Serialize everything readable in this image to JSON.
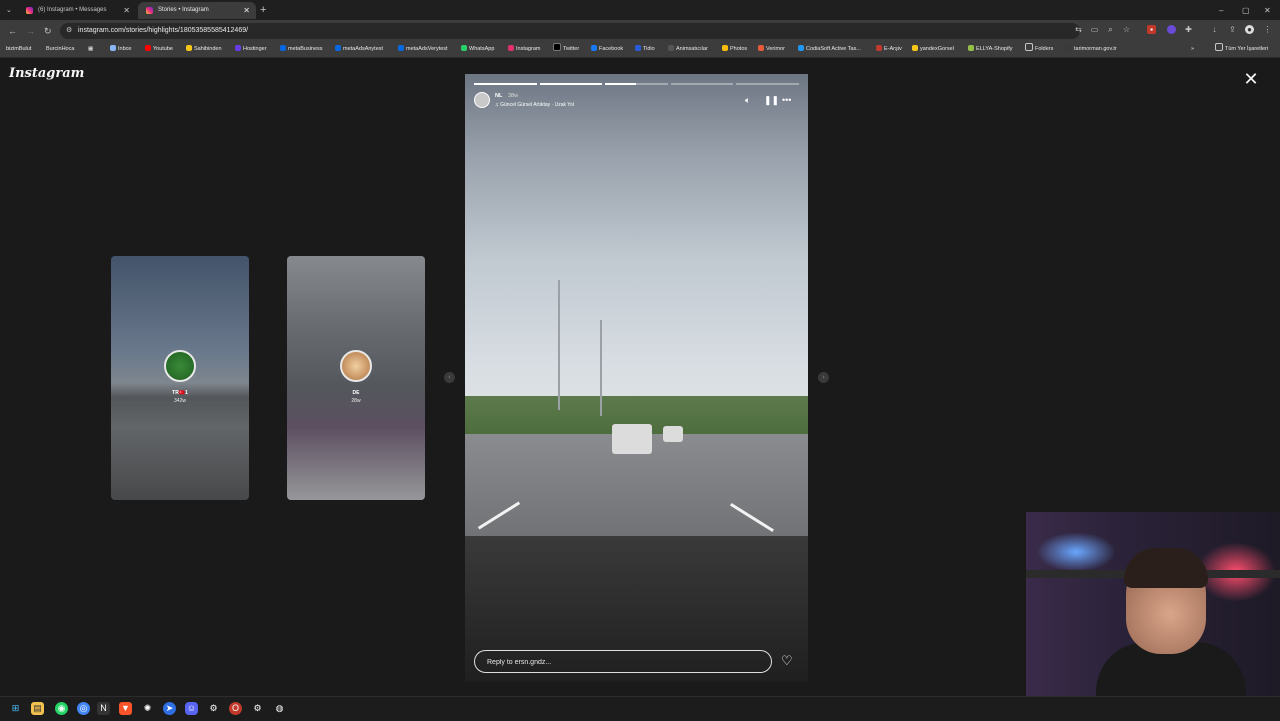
{
  "browser": {
    "tabs": [
      {
        "title": "(6) Instagram • Messages",
        "active": false
      },
      {
        "title": "Stories • Instagram",
        "active": true
      }
    ],
    "address": "instagram.com/stories/highlights/18053585585412469/",
    "bookmarks": [
      "bizimBulut",
      "BurcinHoca",
      "Inbox",
      "Youtube",
      "Sahibinden",
      "Hostinger",
      "metaBusiness",
      "metaAdsAnytest",
      "metaAdsVerytest",
      "WhatsApp",
      "Instagram",
      "Twitter",
      "Facebook",
      "Tidio",
      "Animsatıcılar",
      "Photos",
      "Verimor",
      "CodiaSoft Active Tas...",
      "E-Arşiv",
      "yandexGorsel",
      "ELLYA-Shopify",
      "Folders",
      "tarimorman.gov.tr"
    ],
    "bookmarks_right": "Tüm Yer İşaretleri"
  },
  "page": {
    "logo": "Instagram",
    "previews": [
      {
        "name": "TR🇹🇷1",
        "time": "342w"
      },
      {
        "name": "DE",
        "time": "28w"
      }
    ],
    "story": {
      "username": "NL",
      "time": "38w",
      "song": "Güncel Gürsel Artıktay · Uzak Yol",
      "reply_placeholder": "Reply to ersn.gndz...",
      "progress": [
        1,
        1,
        0.5,
        0,
        0
      ],
      "icons": [
        "mute-icon",
        "pause-icon",
        "more-icon"
      ]
    }
  }
}
